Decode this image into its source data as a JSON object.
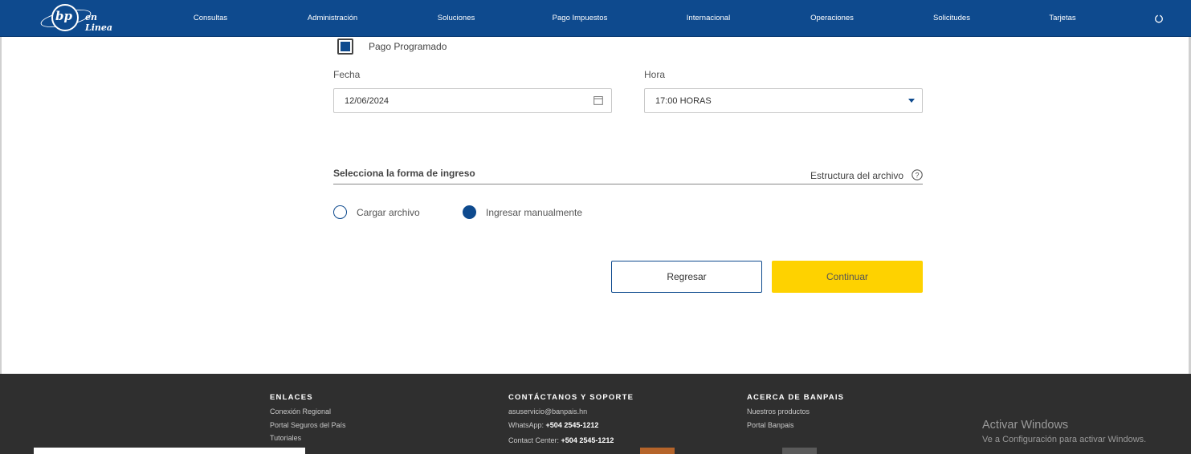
{
  "brand": {
    "logo_mark": "bp",
    "logo_text": "en Linea"
  },
  "nav": {
    "items": [
      {
        "label": "Consultas"
      },
      {
        "label": "Administración"
      },
      {
        "label": "Soluciones"
      },
      {
        "label": "Pago Impuestos"
      },
      {
        "label": "Internacional"
      },
      {
        "label": "Operaciones"
      },
      {
        "label": "Solicitudes"
      },
      {
        "label": "Tarjetas"
      }
    ],
    "power_icon": "power-icon"
  },
  "form": {
    "scheduled_payment_label": "Pago Programado",
    "scheduled_payment_checked": true,
    "date_label": "Fecha",
    "date_value": "12/06/2024",
    "time_label": "Hora",
    "time_value": "17:00 HORAS",
    "entry_section_title": "Selecciona la forma de ingreso",
    "file_structure_link": "Estructura del archivo",
    "entry_options": [
      {
        "label": "Cargar archivo",
        "selected": false
      },
      {
        "label": "Ingresar manualmente",
        "selected": true
      }
    ],
    "back_button": "Regresar",
    "continue_button": "Continuar"
  },
  "footer": {
    "links_heading": "ENLACES",
    "links": [
      "Conexión Regional",
      "Portal Seguros del País",
      "Tutoriales"
    ],
    "contact_heading": "CONTÁCTANOS Y SOPORTE",
    "contact_email": "asuservicio@banpais.hn",
    "whatsapp_label": "WhatsApp:",
    "whatsapp_number": "+504 2545-1212",
    "contact_center_label": "Contact Center:",
    "contact_center_number": "+504 2545-1212",
    "about_heading": "ACERCA DE BANPAIS",
    "about_links": [
      "Nuestros productos",
      "Portal Banpais"
    ]
  },
  "windows_watermark": {
    "title": "Activar Windows",
    "subtitle": "Ve a Configuración para activar Windows."
  },
  "colors": {
    "primary": "#0e4a8e",
    "accent": "#fed200",
    "footer_bg": "#2f2f2f"
  }
}
